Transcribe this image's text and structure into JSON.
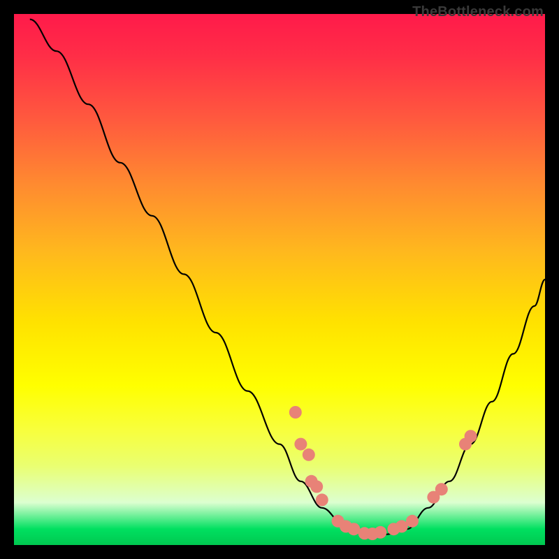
{
  "watermark": "TheBottleneck.com",
  "chart_data": {
    "type": "line",
    "title": "",
    "xlabel": "",
    "ylabel": "",
    "xlim": [
      0,
      100
    ],
    "ylim": [
      0,
      100
    ],
    "grid": false,
    "legend": false,
    "series": [
      {
        "name": "curve",
        "color": "#000000",
        "x": [
          3,
          8,
          14,
          20,
          26,
          32,
          38,
          44,
          50,
          54,
          58,
          62,
          66,
          70,
          74,
          78,
          82,
          86,
          90,
          94,
          98,
          100
        ],
        "y": [
          99,
          93,
          83,
          72,
          62,
          51,
          40,
          29,
          19,
          12,
          7,
          4,
          2,
          2,
          3,
          7,
          12,
          19,
          27,
          36,
          45,
          50
        ]
      }
    ],
    "markers": [
      {
        "x": 53.0,
        "y": 25.0
      },
      {
        "x": 54.0,
        "y": 19.0
      },
      {
        "x": 55.5,
        "y": 17.0
      },
      {
        "x": 56.0,
        "y": 12.0
      },
      {
        "x": 57.0,
        "y": 11.0
      },
      {
        "x": 58.0,
        "y": 8.5
      },
      {
        "x": 61.0,
        "y": 4.5
      },
      {
        "x": 62.5,
        "y": 3.5
      },
      {
        "x": 64.0,
        "y": 3.0
      },
      {
        "x": 66.0,
        "y": 2.2
      },
      {
        "x": 67.5,
        "y": 2.1
      },
      {
        "x": 69.0,
        "y": 2.4
      },
      {
        "x": 71.5,
        "y": 3.0
      },
      {
        "x": 73.0,
        "y": 3.5
      },
      {
        "x": 75.0,
        "y": 4.5
      },
      {
        "x": 79.0,
        "y": 9.0
      },
      {
        "x": 80.5,
        "y": 10.5
      },
      {
        "x": 85.0,
        "y": 19.0
      },
      {
        "x": 86.0,
        "y": 20.5
      }
    ],
    "marker_color": "#e88277",
    "marker_radius": 9
  }
}
